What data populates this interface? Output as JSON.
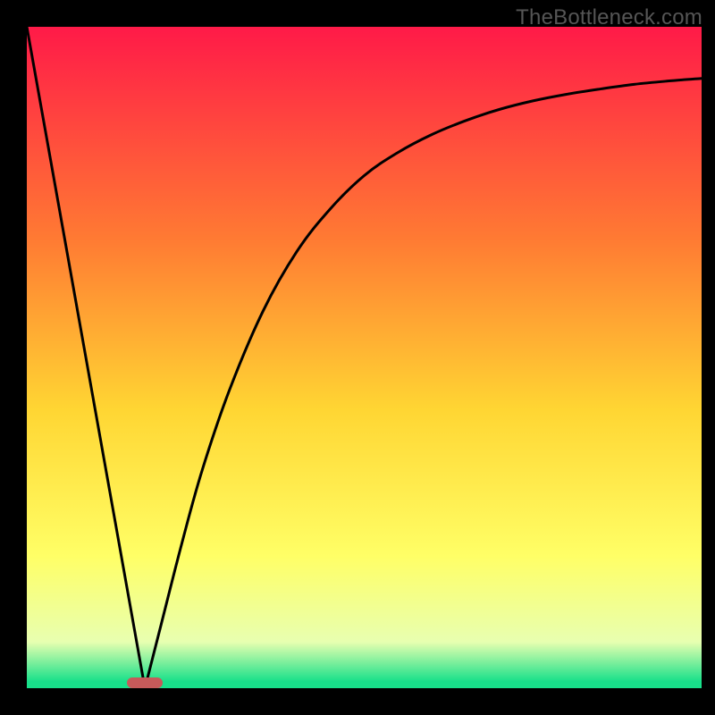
{
  "watermark": "TheBottleneck.com",
  "chart_data": {
    "type": "line",
    "title": "",
    "xlabel": "",
    "ylabel": "",
    "xlim": [
      0,
      100
    ],
    "ylim": [
      0,
      100
    ],
    "grid": false,
    "legend": false,
    "background_gradient": {
      "top": "#ff1a48",
      "mid_upper": "#ff7a33",
      "mid": "#ffd633",
      "mid_lower": "#ffff66",
      "near_bottom": "#e8ffb0",
      "bottom": "#18e08a"
    },
    "series": [
      {
        "name": "left-line",
        "x": [
          0,
          17.5
        ],
        "y": [
          100,
          0
        ]
      },
      {
        "name": "right-curve",
        "x": [
          17.5,
          20,
          23,
          26,
          30,
          35,
          40,
          45,
          50,
          55,
          60,
          65,
          70,
          75,
          80,
          85,
          90,
          95,
          100
        ],
        "y": [
          0,
          10,
          22,
          33,
          45,
          57,
          66,
          72.5,
          77.5,
          81,
          83.7,
          85.8,
          87.5,
          88.8,
          89.8,
          90.6,
          91.3,
          91.8,
          92.2
        ]
      }
    ],
    "marker": {
      "x_center": 17.5,
      "width_pct": 5.3,
      "color": "#c65a5a"
    }
  }
}
